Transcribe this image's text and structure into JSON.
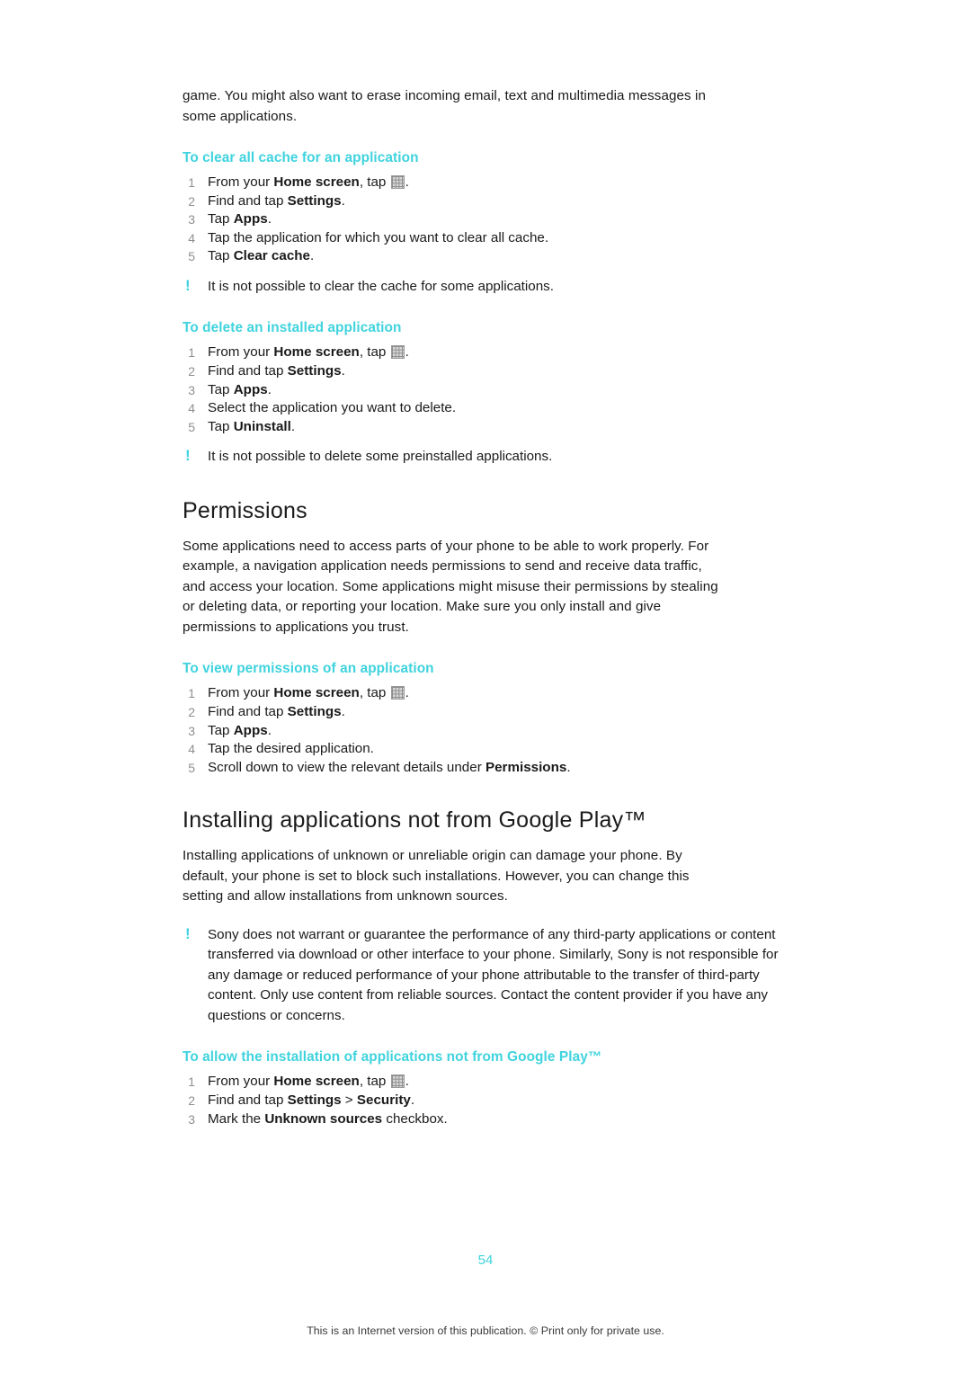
{
  "page": {
    "number": "54",
    "footer": "This is an Internet version of this publication. © Print only for private use.",
    "accent_color": "#3fd3de"
  },
  "intro": {
    "line1": "game. You might also want to erase incoming email, text and multimedia messages in",
    "line2": "some applications."
  },
  "proc_clear_cache": {
    "title": "To clear all cache for an application",
    "steps": [
      {
        "num": "1",
        "pre": "From your ",
        "bold": "Home screen",
        "post": ", tap ",
        "icon": "apps-grid-icon",
        "tail": "."
      },
      {
        "num": "2",
        "pre": "Find and tap ",
        "bold": "Settings",
        "post": "."
      },
      {
        "num": "3",
        "pre": "Tap ",
        "bold": "Apps",
        "post": "."
      },
      {
        "num": "4",
        "pre": "Tap the application for which you want to clear all cache.",
        "bold": "",
        "post": ""
      },
      {
        "num": "5",
        "pre": "Tap ",
        "bold": "Clear cache",
        "post": "."
      }
    ],
    "note": "It is not possible to clear the cache for some applications."
  },
  "proc_delete_app": {
    "title": "To delete an installed application",
    "steps": [
      {
        "num": "1",
        "pre": "From your ",
        "bold": "Home screen",
        "post": ", tap ",
        "icon": "apps-grid-icon",
        "tail": "."
      },
      {
        "num": "2",
        "pre": "Find and tap ",
        "bold": "Settings",
        "post": "."
      },
      {
        "num": "3",
        "pre": "Tap ",
        "bold": "Apps",
        "post": "."
      },
      {
        "num": "4",
        "pre": "Select the application you want to delete.",
        "bold": "",
        "post": ""
      },
      {
        "num": "5",
        "pre": "Tap ",
        "bold": "Uninstall",
        "post": "."
      }
    ],
    "note": "It is not possible to delete some preinstalled applications."
  },
  "permissions": {
    "heading": "Permissions",
    "body_lines": [
      "Some applications need to access parts of your phone to be able to work properly. For",
      "example, a navigation application needs permissions to send and receive data traffic,",
      "and access your location. Some applications might misuse their permissions by stealing",
      "or deleting data, or reporting your location. Make sure you only install and give",
      "permissions to applications you trust."
    ]
  },
  "proc_view_permissions": {
    "title": "To view permissions of an application",
    "steps": [
      {
        "num": "1",
        "pre": "From your ",
        "bold": "Home screen",
        "post": ", tap ",
        "icon": "apps-grid-icon",
        "tail": "."
      },
      {
        "num": "2",
        "pre": "Find and tap ",
        "bold": "Settings",
        "post": "."
      },
      {
        "num": "3",
        "pre": "Tap ",
        "bold": "Apps",
        "post": "."
      },
      {
        "num": "4",
        "pre": "Tap the desired application.",
        "bold": "",
        "post": ""
      },
      {
        "num": "5",
        "pre": "Scroll down to view the relevant details under ",
        "bold": "Permissions",
        "post": "."
      }
    ]
  },
  "installing": {
    "heading": "Installing applications not from Google Play™",
    "body_lines": [
      "Installing applications of unknown or unreliable origin can damage your phone. By",
      "default, your phone is set to block such installations. However, you can change this",
      "setting and allow installations from unknown sources."
    ],
    "note_lines": [
      "Sony does not warrant or guarantee the performance of any third-party applications or content",
      "transferred via download or other interface to your phone. Similarly, Sony is not responsible for",
      "any damage or reduced performance of your phone attributable to the transfer of third-party",
      "content. Only use content from reliable sources. Contact the content provider if you have any",
      "questions or concerns."
    ]
  },
  "proc_allow_install": {
    "title": "To allow the installation of applications not from Google Play™",
    "steps": [
      {
        "num": "1",
        "pre": "From your ",
        "bold": "Home screen",
        "post": ", tap ",
        "icon": "apps-grid-icon",
        "tail": "."
      },
      {
        "num": "2",
        "pre": "Find and tap ",
        "bold": "Settings",
        "mid": " > ",
        "bold2": "Security",
        "post": "."
      },
      {
        "num": "3",
        "pre": "Mark the ",
        "bold": "Unknown sources",
        "post": " checkbox."
      }
    ]
  }
}
